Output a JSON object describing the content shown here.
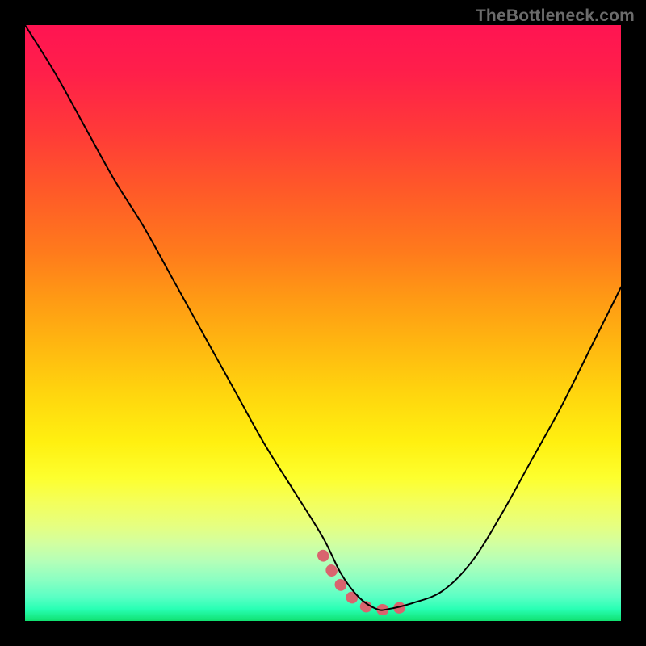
{
  "watermark": "TheBottleneck.com",
  "colors": {
    "background": "#000000",
    "gradient_top": "#ff1452",
    "gradient_bottom": "#10e070",
    "curve": "#000000",
    "ideal_band": "#d9646e",
    "watermark": "#6b6b6b"
  },
  "chart_data": {
    "type": "line",
    "title": "",
    "xlabel": "",
    "ylabel": "",
    "xlim": [
      0,
      100
    ],
    "ylim": [
      0,
      100
    ],
    "grid": false,
    "legend": false,
    "series": [
      {
        "name": "bottleneck-curve",
        "x": [
          0,
          5,
          10,
          15,
          20,
          25,
          30,
          35,
          40,
          45,
          50,
          53,
          56,
          59,
          61,
          65,
          70,
          75,
          80,
          85,
          90,
          95,
          100
        ],
        "y": [
          100,
          92,
          83,
          74,
          66,
          57,
          48,
          39,
          30,
          22,
          14,
          8,
          4,
          2,
          2,
          3,
          5,
          10,
          18,
          27,
          36,
          46,
          56
        ]
      },
      {
        "name": "ideal-band",
        "x": [
          50,
          53,
          56,
          59,
          62,
          65
        ],
        "y": [
          11,
          6,
          3,
          2,
          2,
          3
        ]
      }
    ],
    "annotations": []
  }
}
